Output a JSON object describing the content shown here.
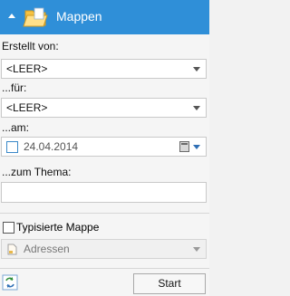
{
  "header": {
    "title": "Mappen",
    "collapse_icon": "collapse-up-icon",
    "folder_icon": "open-folder-icon"
  },
  "fields": {
    "creator_label": "Erstellt von:",
    "creator_value": "<LEER>",
    "for_label": "...für:",
    "for_value": "<LEER>",
    "date_label": "...am:",
    "date_value": "24.04.2014",
    "topic_label": "...zum Thema:",
    "topic_value": ""
  },
  "typed_folder": {
    "label": "Typisierte Mappe",
    "checked": false,
    "type_value": "Adressen"
  },
  "footer": {
    "start_label": "Start",
    "refresh_icon": "refresh-icon"
  },
  "colors": {
    "header_bg": "#2f8fd8",
    "accent_blue": "#3a88c8"
  }
}
